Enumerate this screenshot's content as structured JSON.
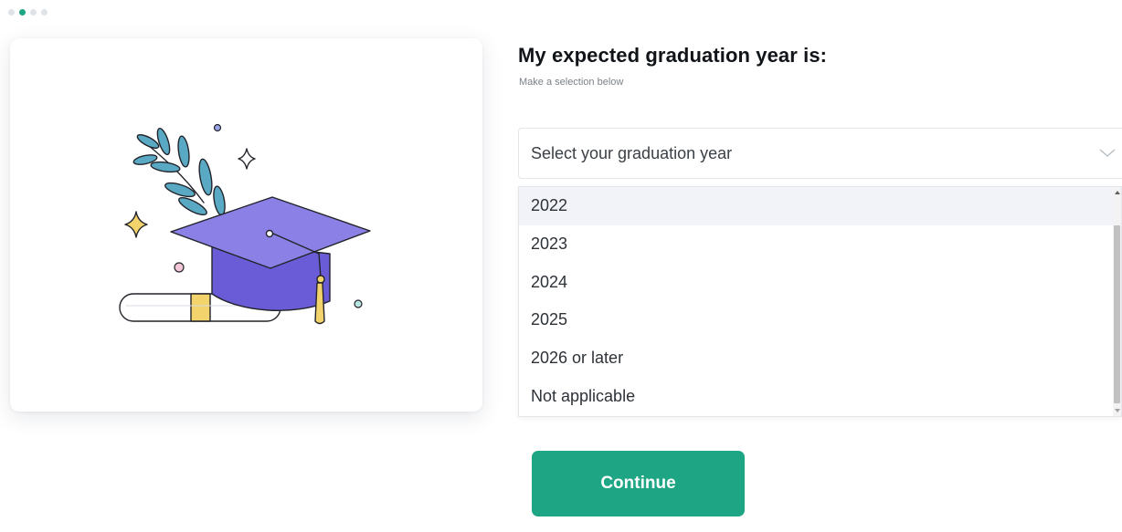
{
  "progress": {
    "total_steps": 4,
    "current_step": 2
  },
  "colors": {
    "accent": "#1ea584",
    "cap": "#7b6fe0",
    "cap_dark": "#6a5bd6",
    "leaf": "#5aa9c4",
    "tassel": "#f3d36b",
    "sparkle": "#f3d36b"
  },
  "illustration": {
    "icons": [
      "leaf-branch-icon",
      "graduation-cap-icon",
      "diploma-scroll-icon",
      "sparkle-icon",
      "circle-icon"
    ]
  },
  "question": {
    "title": "My expected graduation year is:",
    "subtitle": "Make a selection below"
  },
  "select": {
    "placeholder": "Select your graduation year",
    "icon": "chevron-down-icon",
    "options": [
      "2022",
      "2023",
      "2024",
      "2025",
      "2026 or later",
      "Not applicable"
    ],
    "highlighted_index": 0
  },
  "actions": {
    "continue_label": "Continue"
  }
}
